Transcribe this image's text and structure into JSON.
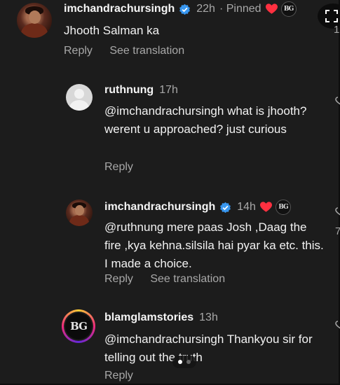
{
  "comments": {
    "c1": {
      "username": "imchandrachursingh",
      "time": "22h",
      "pinned": "· Pinned",
      "text": "Jhooth Salman ka",
      "reply": "Reply",
      "translate": "See translation",
      "badge": "BG"
    },
    "c2": {
      "username": "ruthnung",
      "time": "17h",
      "text": "@imchandrachursingh what is jhooth?  werent u approached?  just curious",
      "reply": "Reply"
    },
    "c3": {
      "username": "imchandrachursingh",
      "time": "14h",
      "text": "@ruthnung mere paas Josh ,Daag the fire ,kya kehna.silsila hai pyar ka etc. this. I made a choice.",
      "reply": "Reply",
      "translate": "See translation",
      "badge": "BG"
    },
    "c4": {
      "username": "blamglamstories",
      "time": "13h",
      "text": "@imchandrachursingh Thankyou sir for telling out the truth",
      "reply": "Reply",
      "avatar_text": "BG"
    }
  },
  "edge_counts": [
    "1",
    "7"
  ],
  "colors": {
    "background": "#1c1c1c",
    "verified": "#3897f0",
    "heart": "#ff3040",
    "muted": "#a8a8a8"
  },
  "icons": [
    "verified-icon",
    "heart-icon",
    "bg-badge-icon",
    "expand-icon",
    "like-icon"
  ]
}
